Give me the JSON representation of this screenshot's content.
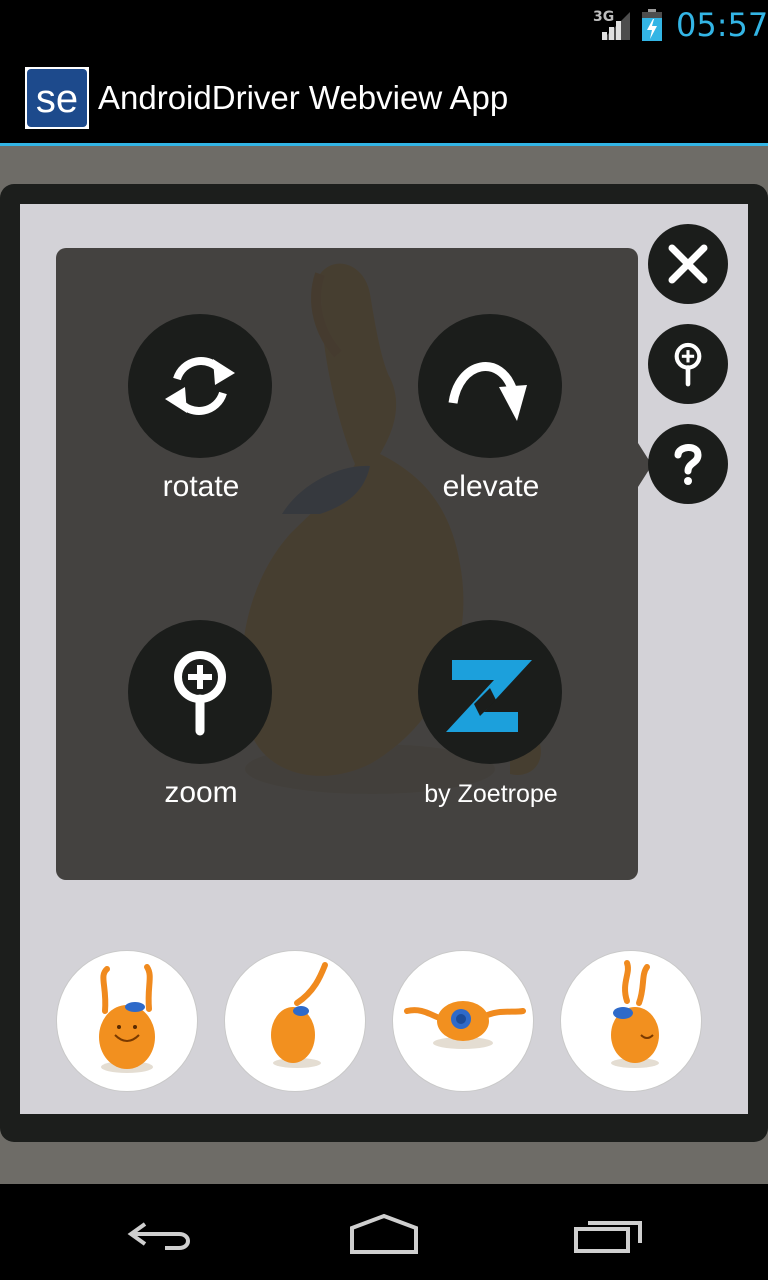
{
  "status_bar": {
    "network": "3G",
    "time": "05:57",
    "colors": {
      "clock": "#33b5e5"
    },
    "icons": [
      "signal-icon",
      "battery-charging-icon"
    ]
  },
  "action_bar": {
    "logo_text": "se",
    "title": "AndroidDriver Webview App",
    "colors": {
      "divider": "#33b5e5",
      "logo": "#1d4a8c"
    }
  },
  "help_overlay": {
    "buttons": [
      {
        "label": "rotate",
        "icon": "rotate-icon"
      },
      {
        "label": "elevate",
        "icon": "elevate-icon"
      },
      {
        "label": "zoom",
        "icon": "zoom-icon"
      },
      {
        "label": "by Zoetrope",
        "icon": "zoetrope-logo-icon"
      }
    ],
    "colors": {
      "zoetrope": "#1ca0dc"
    }
  },
  "side_controls": [
    {
      "name": "close",
      "icon": "close-icon"
    },
    {
      "name": "zoom",
      "icon": "zoom-icon"
    },
    {
      "name": "help",
      "icon": "help-icon"
    }
  ],
  "thumbnails": [
    {
      "name": "front view",
      "icon": "product-thumbnail"
    },
    {
      "name": "side view",
      "icon": "product-thumbnail"
    },
    {
      "name": "top view",
      "icon": "product-thumbnail"
    },
    {
      "name": "three-quarter view",
      "icon": "product-thumbnail"
    }
  ],
  "nav_bar": {
    "icons": [
      "back-icon",
      "home-icon",
      "recent-apps-icon"
    ]
  }
}
